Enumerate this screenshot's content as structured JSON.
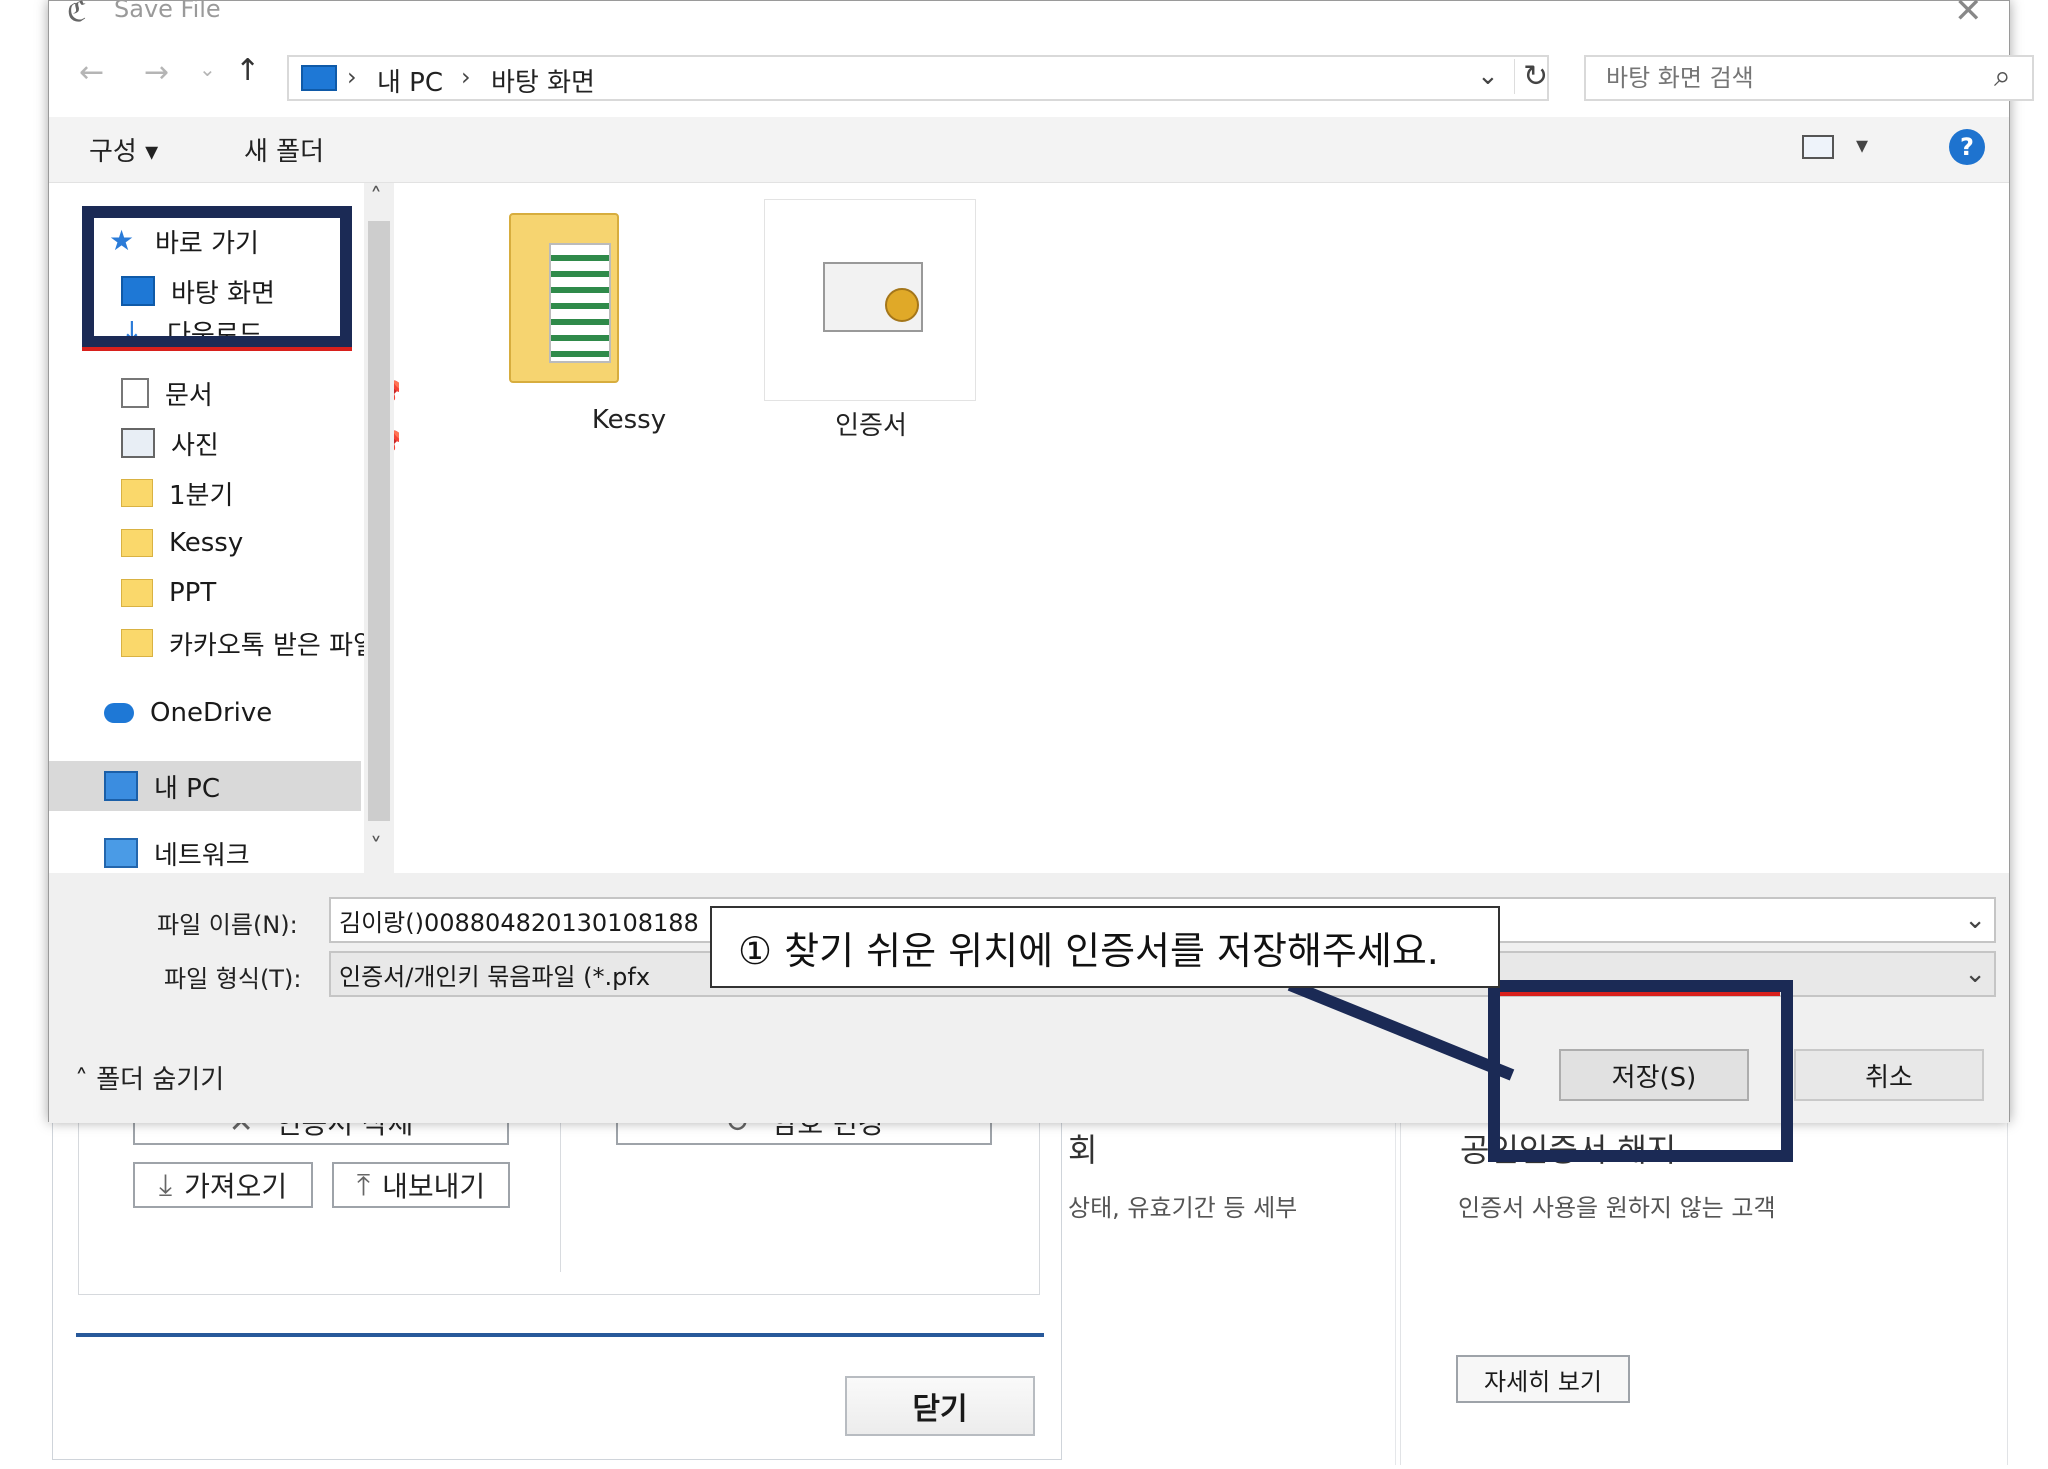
{
  "dialog": {
    "title": "Save File",
    "address": {
      "segment1": "내 PC",
      "segment2": "바탕 화면",
      "sep": "›"
    },
    "search_placeholder": "바탕 화면 검색",
    "toolbar": {
      "organize": "구성 ▾",
      "new_folder": "새 폴더"
    },
    "nav": [
      {
        "label": "바로 가기"
      },
      {
        "label": "바탕 화면"
      },
      {
        "label": "다운로드"
      },
      {
        "label": "문서"
      },
      {
        "label": "사진"
      },
      {
        "label": "1분기"
      },
      {
        "label": "Kessy"
      },
      {
        "label": "PPT"
      },
      {
        "label": "카카오톡 받은 파일"
      },
      {
        "label": "OneDrive"
      },
      {
        "label": "내 PC"
      },
      {
        "label": "네트워크"
      }
    ],
    "files": [
      {
        "label": "Kessy"
      },
      {
        "label": "인증서"
      }
    ],
    "filename_label": "파일 이름(N):",
    "filename_value": "김이랑()008804820130108188",
    "filetype_label": "파일 형식(T):",
    "filetype_value": "인증서/개인키 묶음파일 (*.pfx",
    "hide_folders": "폴더 숨기기",
    "save": "저장(S)",
    "cancel": "취소"
  },
  "annotation": {
    "callout": "① 찾기 쉬운 위치에 인증서를 저장해주세요."
  },
  "background": {
    "delete": "인증서 삭제",
    "change_pw": "암호 변경",
    "import": "가져오기",
    "export": "내보내기",
    "close": "닫기",
    "text1": "회",
    "text2": "상태, 유효기간 등 세부",
    "text3": "공인인증서 해지",
    "text4": "인증서 사용을 원하지 않는 고객",
    "detail": "자세히 보기"
  },
  "colors": {
    "highlight": "#1b2a55",
    "red_line": "#d8201c",
    "help": "#1e73cf",
    "accent_line": "#28599a"
  }
}
